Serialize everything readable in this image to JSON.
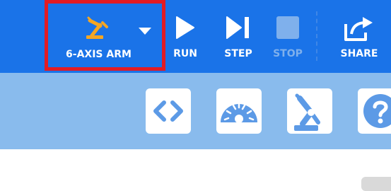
{
  "toolbar": {
    "robot_selector": {
      "label": "6-AXIS ARM",
      "icon": "robot-arm-icon"
    },
    "run_label": "RUN",
    "step_label": "STEP",
    "stop_label": "STOP",
    "share_label": "SHARE"
  },
  "subbar": {
    "tiles": [
      {
        "icon": "code-icon"
      },
      {
        "icon": "speedometer-icon"
      },
      {
        "icon": "robot-arm-icon"
      },
      {
        "icon": "help-icon"
      }
    ]
  },
  "colors": {
    "toolbar_bg": "#1a73e8",
    "subbar_bg": "#89bbed",
    "highlight_border": "#e31b23",
    "robot_icon": "#f5a623",
    "tile_icon": "#5c9ae6"
  }
}
